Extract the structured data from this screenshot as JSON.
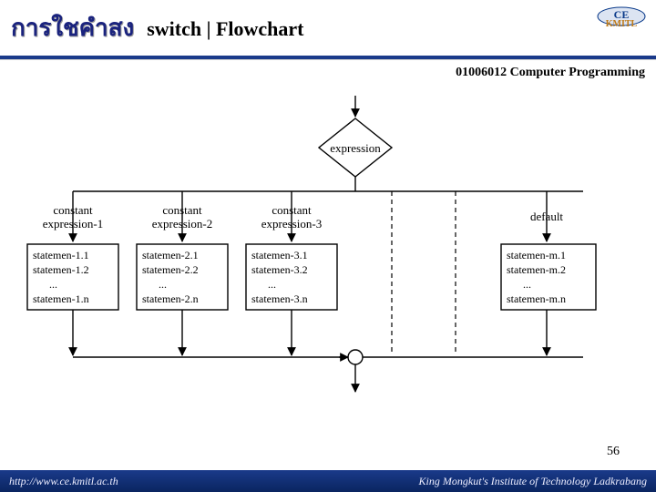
{
  "header": {
    "thai_title": "การใชคำสง",
    "en_title": "switch | Flowchart",
    "course": "01006012 Computer Programming"
  },
  "logo": {
    "line1": "CE",
    "line2": "KMITL"
  },
  "flow": {
    "expression": "expression",
    "branches": [
      {
        "label_l1": "constant",
        "label_l2": "expression-1",
        "stmts": [
          "statemen-1.1",
          "statemen-1.2",
          "...",
          "statemen-1.n"
        ]
      },
      {
        "label_l1": "constant",
        "label_l2": "expression-2",
        "stmts": [
          "statemen-2.1",
          "statemen-2.2",
          "...",
          "statemen-2.n"
        ]
      },
      {
        "label_l1": "constant",
        "label_l2": "expression-3",
        "stmts": [
          "statemen-3.1",
          "statemen-3.2",
          "...",
          "statemen-3.n"
        ]
      },
      {
        "label_l1": "default",
        "label_l2": "",
        "stmts": [
          "statemen-m.1",
          "statemen-m.2",
          "...",
          "statemen-m.n"
        ]
      }
    ]
  },
  "page_number": "56",
  "footer": {
    "left": "http://www.ce.kmitl.ac.th",
    "right": "King Mongkut's Institute of Technology Ladkrabang"
  }
}
